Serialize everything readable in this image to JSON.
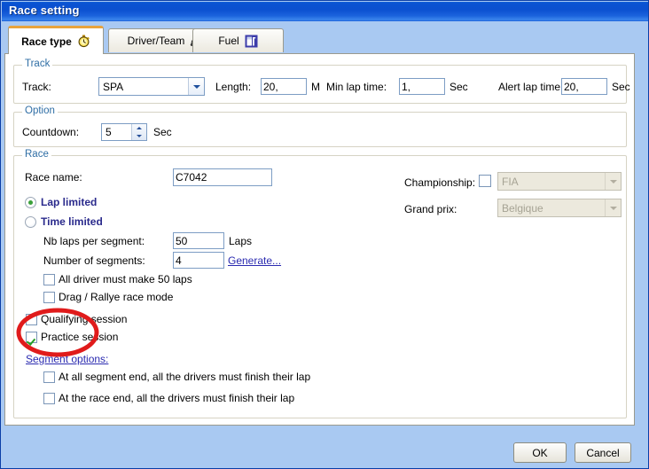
{
  "window": {
    "title": "Race setting"
  },
  "tabs": [
    {
      "label": "Race type",
      "icon": "stopwatch-icon",
      "selected": true
    },
    {
      "label": "Driver/Team",
      "icon": "helmet-icon",
      "selected": false
    },
    {
      "label": "Fuel",
      "icon": "fuel-pump-icon",
      "selected": false
    }
  ],
  "track_group": {
    "title": "Track",
    "track_label": "Track:",
    "track_value": "SPA",
    "length_label": "Length:",
    "length_value": "20,",
    "length_unit": "M",
    "min_lap_label": "Min lap time:",
    "min_lap_value": "1,",
    "min_lap_unit": "Sec",
    "alert_lap_label": "Alert lap time:",
    "alert_lap_value": "20,",
    "alert_lap_unit": "Sec"
  },
  "option_group": {
    "title": "Option",
    "countdown_label": "Countdown:",
    "countdown_value": "5",
    "countdown_unit": "Sec"
  },
  "race_group": {
    "title": "Race",
    "race_name_label": "Race name:",
    "race_name_value": "C7042",
    "lap_limited_label": "Lap limited",
    "time_limited_label": "Time limited",
    "nb_laps_label": "Nb laps per segment:",
    "nb_laps_value": "50",
    "nb_laps_unit": "Laps",
    "nb_segments_label": "Number of segments:",
    "nb_segments_value": "4",
    "generate_link": "Generate...",
    "all_driver_label": "All driver must make 50 laps",
    "drag_rallye_label": "Drag / Rallye race mode",
    "qualifying_label": "Qualifying session",
    "practice_label": "Practice session",
    "segment_options_label": "Segment options:",
    "at_all_segment_label": "At all segment end, all the drivers must finish their lap",
    "at_race_end_label": "At the race end, all the drivers must finish their lap",
    "championship_label": "Championship:",
    "championship_value": "FIA",
    "grand_prix_label": "Grand prix:",
    "grand_prix_value": "Belgique"
  },
  "footer": {
    "ok_label": "OK",
    "cancel_label": "Cancel"
  },
  "annotation": {
    "color": "#e01b1b",
    "shape": "ellipse",
    "target": "practice-session-checkbox"
  },
  "colors": {
    "title_bar": "#0b50d0",
    "dialog_background": "#a9c9f2",
    "group_label": "#2f6ea5",
    "radio_label": "#2a2a8c",
    "link": "#2a2ab0",
    "selected_tab_accent": "#e8a33d",
    "checkmark": "#24a024",
    "radio_dot": "#3aa03a"
  }
}
